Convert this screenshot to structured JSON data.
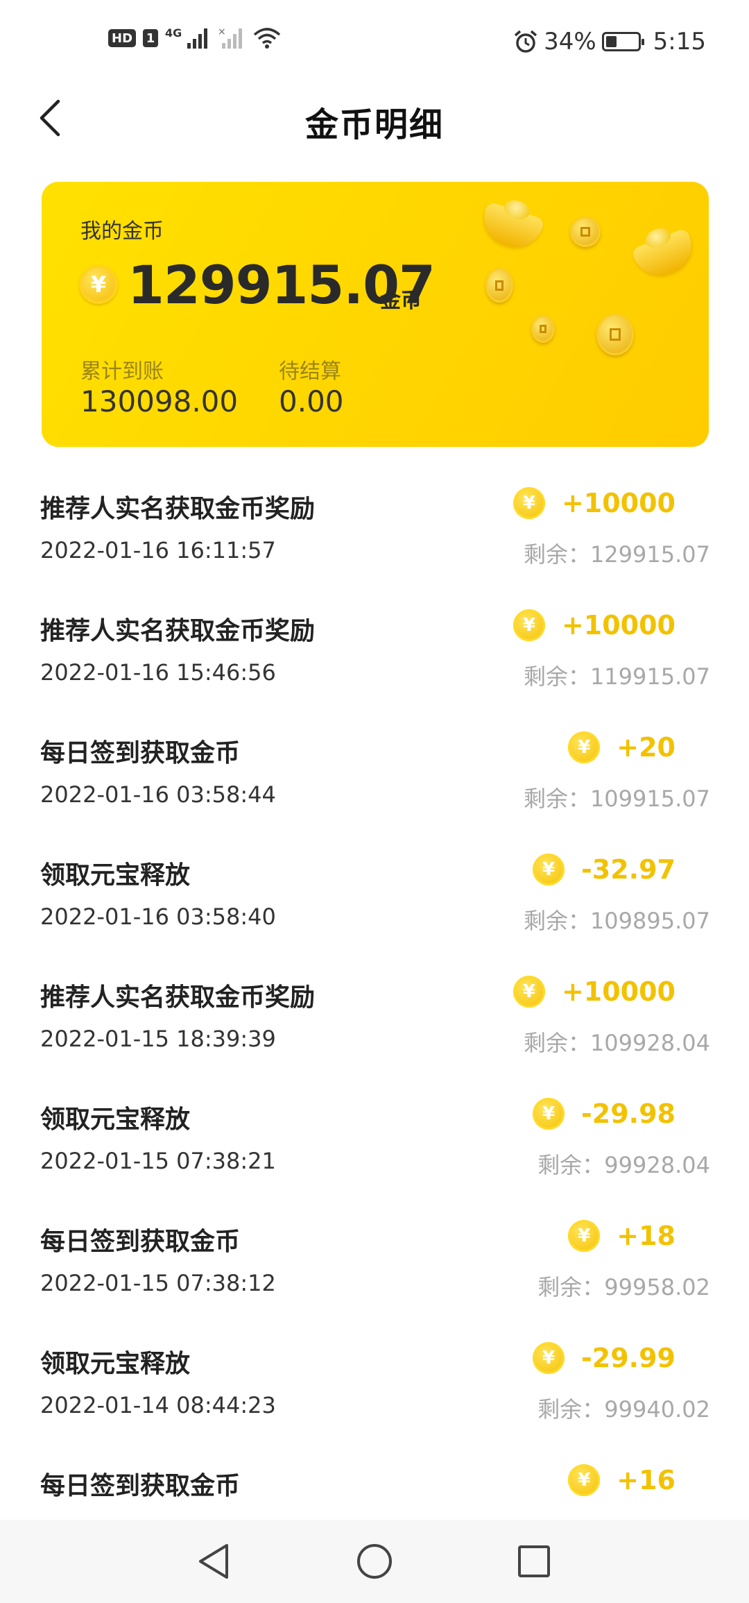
{
  "status_bar": {
    "hd_label": "HD",
    "sim_label": "1",
    "network_label": "4G",
    "battery_percent": "34%",
    "battery_level": 0.34,
    "time": "5:15",
    "icons": [
      "signal-icon",
      "wifi-icon",
      "alarm-icon",
      "battery-icon"
    ]
  },
  "header": {
    "title": "金币明细",
    "back_icon": "chevron-left-icon"
  },
  "card": {
    "label": "我的金币",
    "balance": "129915.07",
    "unit": "金币",
    "coin_symbol": "¥",
    "stats": [
      {
        "label": "累计到账",
        "value": "130098.00"
      },
      {
        "label": "待结算",
        "value": "0.00"
      }
    ]
  },
  "transactions": [
    {
      "title": "推荐人实名获取金币奖励",
      "date": "2022-01-16 16:11:57",
      "amount": "+10000",
      "remain": "剩余：129915.07"
    },
    {
      "title": "推荐人实名获取金币奖励",
      "date": "2022-01-16 15:46:56",
      "amount": "+10000",
      "remain": "剩余：119915.07"
    },
    {
      "title": "每日签到获取金币",
      "date": "2022-01-16 03:58:44",
      "amount": "+20",
      "remain": "剩余：109915.07"
    },
    {
      "title": "领取元宝释放",
      "date": "2022-01-16 03:58:40",
      "amount": "-32.97",
      "remain": "剩余：109895.07"
    },
    {
      "title": "推荐人实名获取金币奖励",
      "date": "2022-01-15 18:39:39",
      "amount": "+10000",
      "remain": "剩余：109928.04"
    },
    {
      "title": "领取元宝释放",
      "date": "2022-01-15 07:38:21",
      "amount": "-29.98",
      "remain": "剩余：99928.04"
    },
    {
      "title": "每日签到获取金币",
      "date": "2022-01-15 07:38:12",
      "amount": "+18",
      "remain": "剩余：99958.02"
    },
    {
      "title": "领取元宝释放",
      "date": "2022-01-14 08:44:23",
      "amount": "-29.99",
      "remain": "剩余：99940.02"
    },
    {
      "title": "每日签到获取金币",
      "date": "",
      "amount": "+16",
      "remain": ""
    }
  ],
  "navbar": {
    "icons": [
      "back-triangle-icon",
      "home-circle-icon",
      "recents-square-icon"
    ]
  },
  "colors": {
    "card_yellow": "#ffd400",
    "amount_yellow": "#f2c200",
    "remain_gray": "#a8a8a8"
  }
}
